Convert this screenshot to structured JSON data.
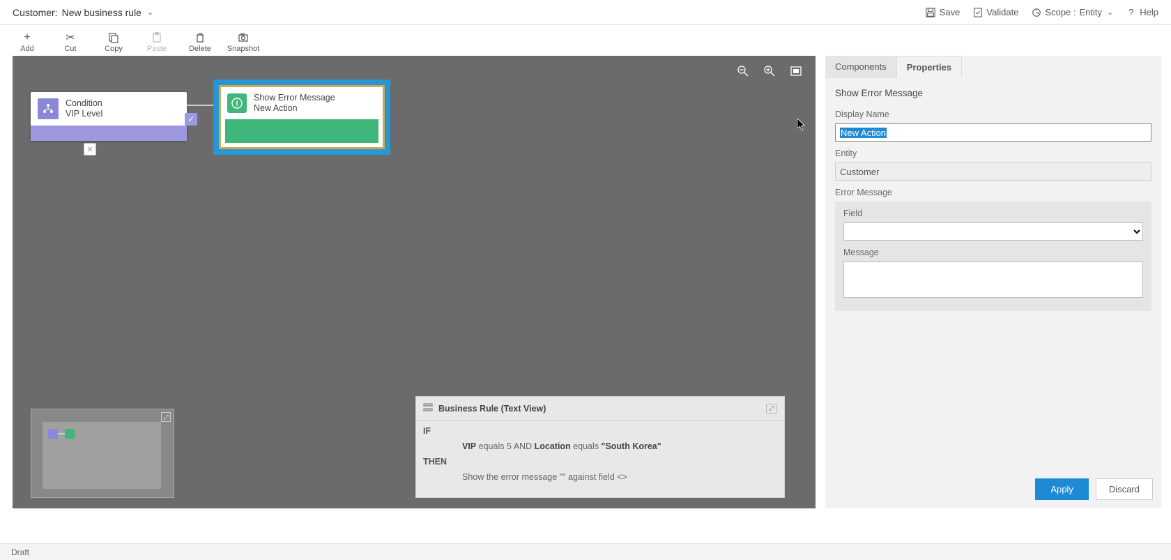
{
  "header": {
    "title_label": "Customer:",
    "title_name": "New business rule",
    "save": "Save",
    "validate": "Validate",
    "scope_label": "Scope :",
    "scope_value": "Entity",
    "help": "Help"
  },
  "actionbar": {
    "add": "Add",
    "cut": "Cut",
    "copy": "Copy",
    "paste": "Paste",
    "delete": "Delete",
    "snapshot": "Snapshot"
  },
  "canvas": {
    "condition": {
      "title": "Condition",
      "sub": "VIP Level"
    },
    "action": {
      "title": "Show Error Message",
      "sub": "New Action"
    }
  },
  "textview": {
    "title": "Business Rule (Text View)",
    "if": "IF",
    "then": "THEN",
    "cond_field1": "VIP",
    "cond_op1": "equals",
    "cond_val1": "5",
    "cond_and": "AND",
    "cond_field2": "Location",
    "cond_op2": "equals",
    "cond_val2": "\"South Korea\"",
    "then_text": "Show the error message \"\" against field <>"
  },
  "properties": {
    "tab_components": "Components",
    "tab_properties": "Properties",
    "heading": "Show Error Message",
    "display_name_label": "Display Name",
    "display_name_value": "New Action",
    "entity_label": "Entity",
    "entity_value": "Customer",
    "error_msg_label": "Error Message",
    "field_label": "Field",
    "message_label": "Message",
    "apply": "Apply",
    "discard": "Discard"
  },
  "status": "Draft"
}
